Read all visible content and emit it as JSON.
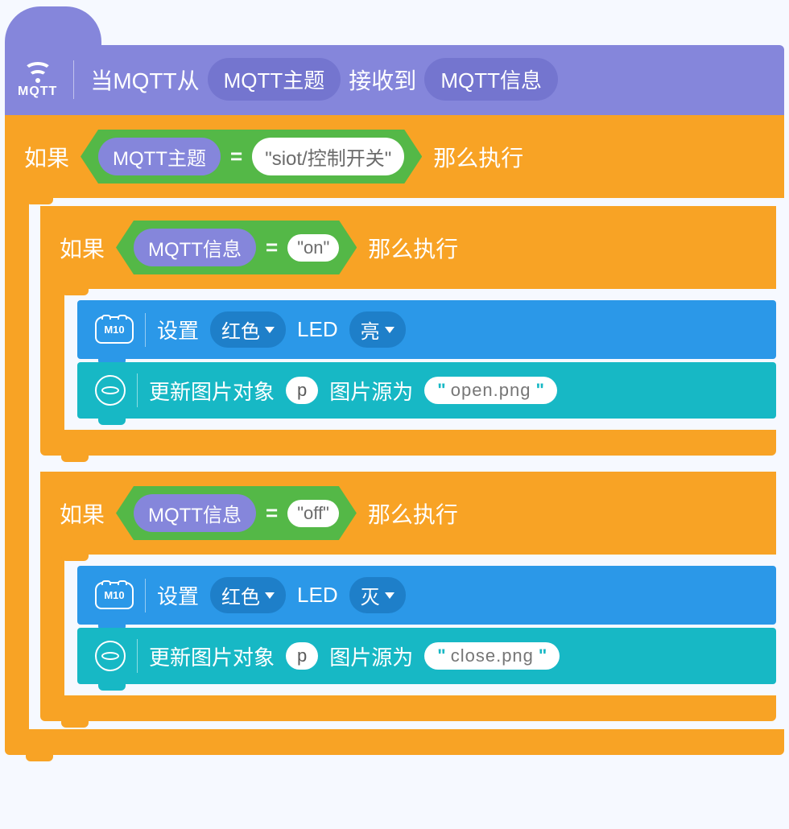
{
  "hat": {
    "icon_label": "MQTT",
    "prefix": "当MQTT从",
    "topic_pill": "MQTT主题",
    "middle": "接收到",
    "message_pill": "MQTT信息"
  },
  "outer_if": {
    "kw_if": "如果",
    "kw_then": "那么执行",
    "operand_reporter": "MQTT主题",
    "eq": "=",
    "operand_literal": "\"siot/控制开关\""
  },
  "if_on": {
    "kw_if": "如果",
    "kw_then": "那么执行",
    "operand_reporter": "MQTT信息",
    "eq": "=",
    "operand_literal": "\"on\""
  },
  "if_off": {
    "kw_if": "如果",
    "kw_then": "那么执行",
    "operand_reporter": "MQTT信息",
    "eq": "=",
    "operand_literal": "\"off\""
  },
  "led_on": {
    "device": "M10",
    "label_set": "设置",
    "dd_color": "红色",
    "label_led": "LED",
    "dd_state": "亮"
  },
  "led_off": {
    "device": "M10",
    "label_set": "设置",
    "dd_color": "红色",
    "label_led": "LED",
    "dd_state": "灭"
  },
  "img_on": {
    "label_a": "更新图片对象",
    "target": "p",
    "label_b": "图片源为",
    "value": "open.png"
  },
  "img_off": {
    "label_a": "更新图片对象",
    "target": "p",
    "label_b": "图片源为",
    "value": "close.png"
  }
}
